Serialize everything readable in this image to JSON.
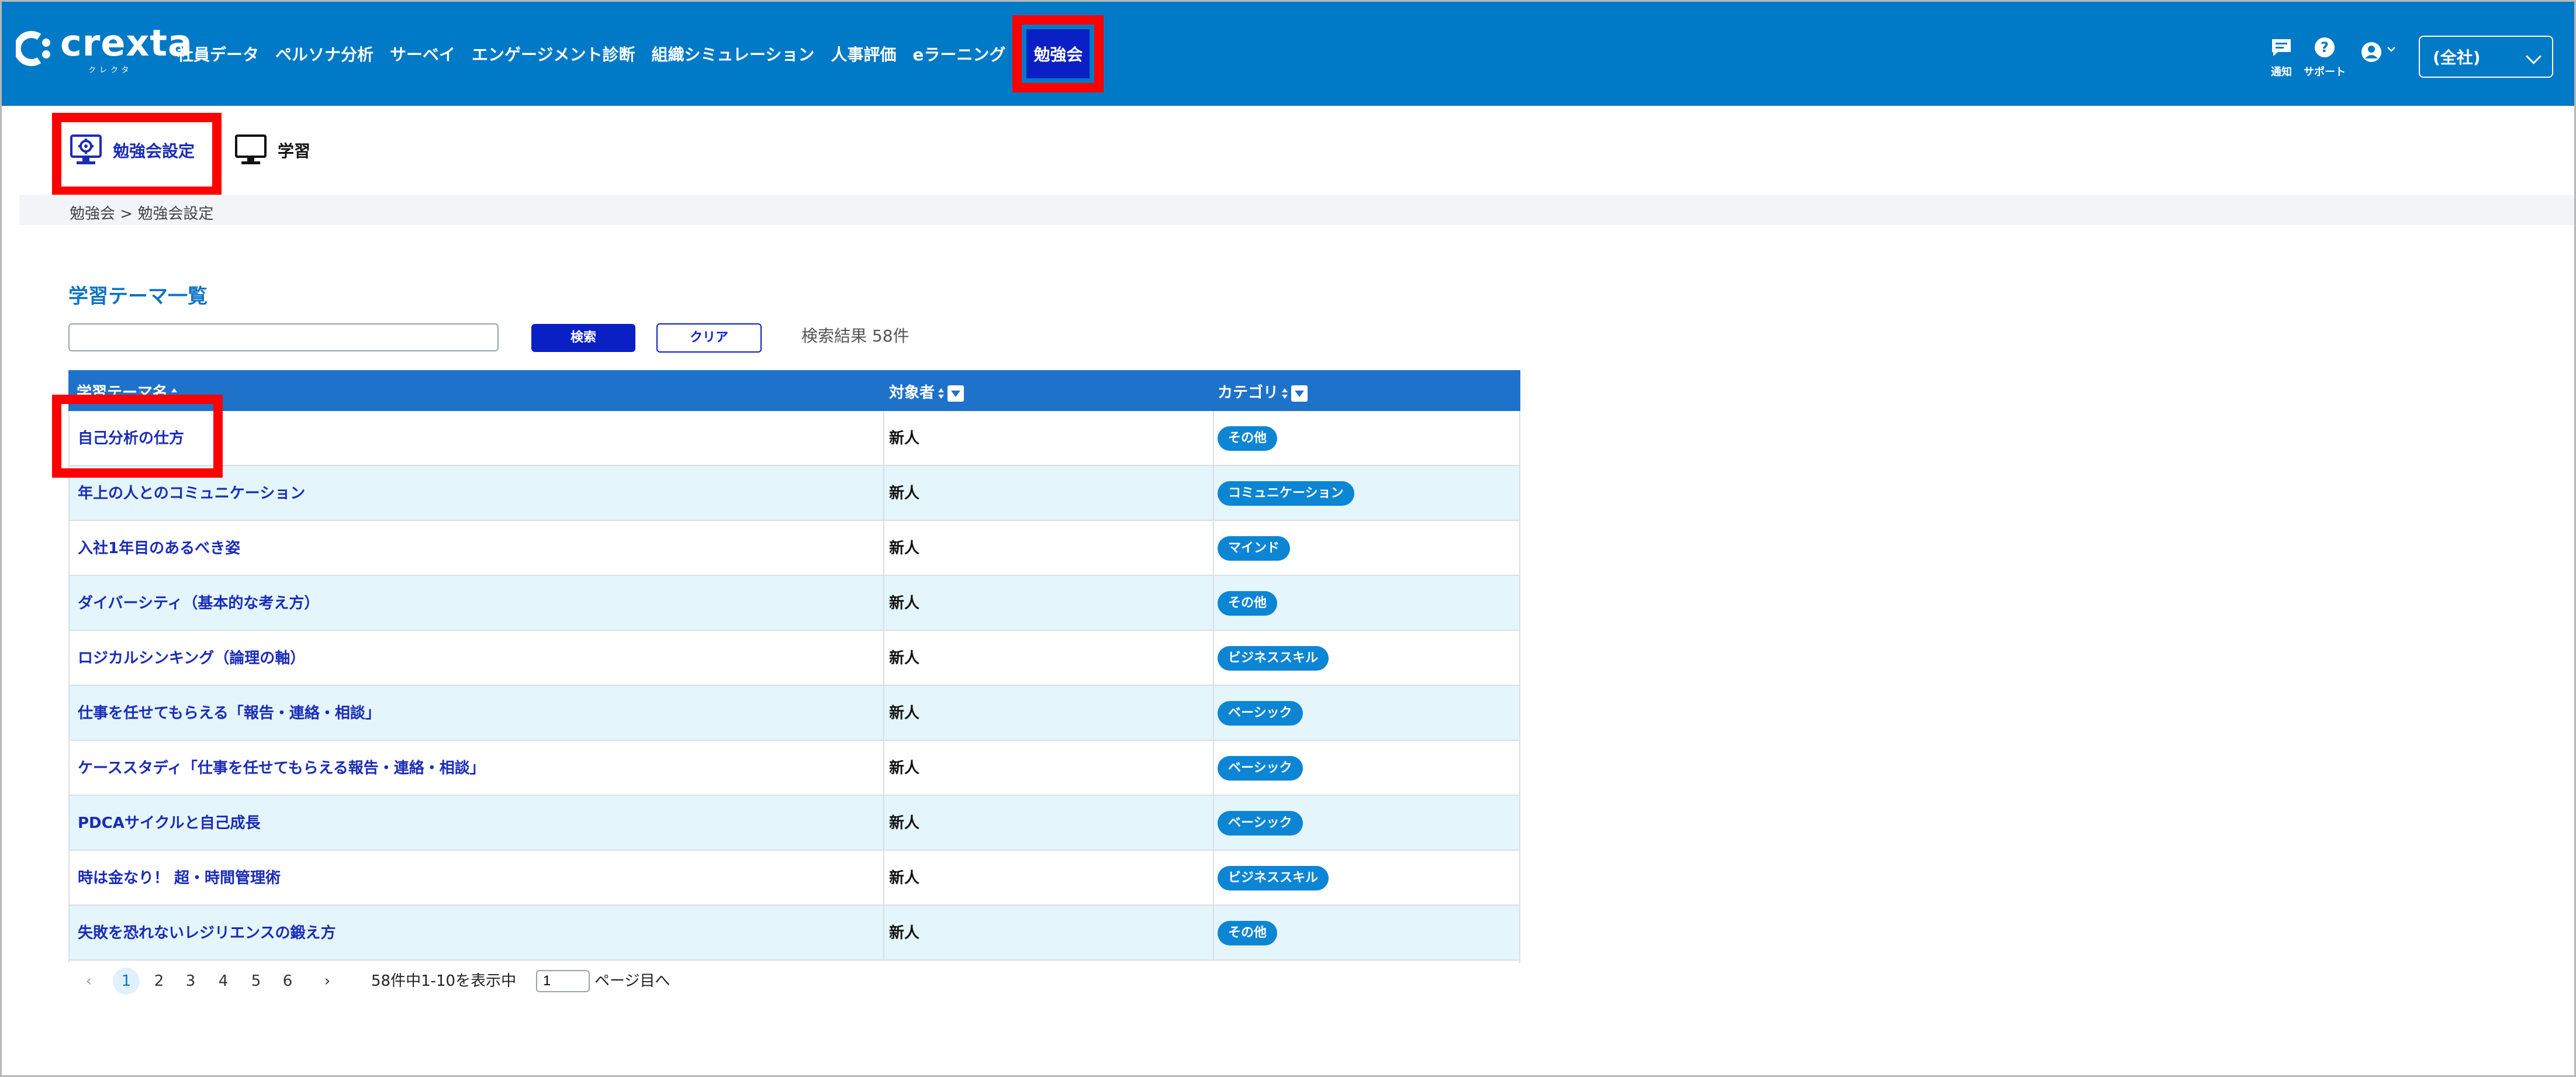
{
  "header": {
    "logo_text": "crexta",
    "logo_sub": "クレクタ",
    "nav": [
      {
        "label": "社員データ"
      },
      {
        "label": "ペルソナ分析"
      },
      {
        "label": "サーベイ"
      },
      {
        "label": "エンゲージメント診断"
      },
      {
        "label": "組織シミュレーション"
      },
      {
        "label": "人事評価"
      },
      {
        "label": "eラーニング"
      },
      {
        "label": "勉強会"
      }
    ],
    "notify_label": "通知",
    "support_label": "サポート",
    "company_select": "(全社)"
  },
  "subnav": {
    "tabs": [
      {
        "label": "勉強会設定"
      },
      {
        "label": "学習"
      }
    ]
  },
  "breadcrumb": "勉強会 > 勉強会設定",
  "main": {
    "title": "学習テーマ一覧",
    "search": {
      "value": "",
      "placeholder": ""
    },
    "search_button": "検索",
    "clear_button": "クリア",
    "result_count": "検索結果 58件",
    "columns": [
      "学習テーマ名",
      "対象者",
      "カテゴリ"
    ],
    "rows": [
      {
        "name": "自己分析の仕方",
        "target": "新人",
        "category": "その他"
      },
      {
        "name": "年上の人とのコミュニケーション",
        "target": "新人",
        "category": "コミュニケーション"
      },
      {
        "name": "入社1年目のあるべき姿",
        "target": "新人",
        "category": "マインド"
      },
      {
        "name": "ダイバーシティ（基本的な考え方）",
        "target": "新人",
        "category": "その他"
      },
      {
        "name": "ロジカルシンキング（論理の軸）",
        "target": "新人",
        "category": "ビジネススキル"
      },
      {
        "name": "仕事を任せてもらえる「報告・連絡・相談」",
        "target": "新人",
        "category": "ベーシック"
      },
      {
        "name": "ケーススタディ「仕事を任せてもらえる報告・連絡・相談」",
        "target": "新人",
        "category": "ベーシック"
      },
      {
        "name": "PDCAサイクルと自己成長",
        "target": "新人",
        "category": "ベーシック"
      },
      {
        "name": "時は金なり！ 超・時間管理術",
        "target": "新人",
        "category": "ビジネススキル"
      },
      {
        "name": "失敗を恐れないレジリエンスの鍛え方",
        "target": "新人",
        "category": "その他"
      }
    ]
  },
  "pagination": {
    "pages": [
      "1",
      "2",
      "3",
      "4",
      "5",
      "6"
    ],
    "prev": "‹",
    "next": "›",
    "info": "58件中1-10を表示中",
    "goto_value": "1",
    "goto_label": "ページ目へ"
  },
  "colors": {
    "header_bg": "#0079c6",
    "accent": "#0a1fc4",
    "link": "#1a2bb8",
    "tag": "#0c85d4",
    "highlight": "#ff0000"
  }
}
